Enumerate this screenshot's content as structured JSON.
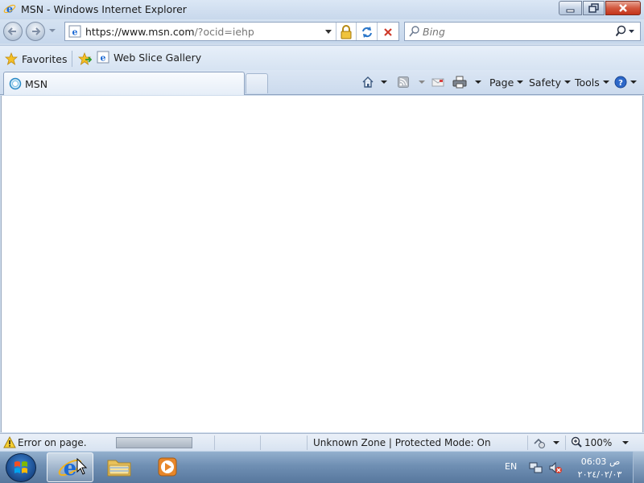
{
  "window": {
    "title": "MSN - Windows Internet Explorer",
    "title_icon": "ie-icon",
    "minimize_icon": "minimize-icon",
    "maximize_icon": "restore-icon",
    "close_icon": "close-icon"
  },
  "navigation": {
    "back_icon": "back-arrow-icon",
    "forward_icon": "forward-arrow-icon",
    "address": {
      "scheme_host": "https://www.msn.com",
      "path": "/?ocid=iehp"
    },
    "security_icon": "lock-icon",
    "refresh_icon": "refresh-icon",
    "stop_icon": "stop-icon",
    "search_placeholder": "Bing"
  },
  "favorites_bar": {
    "favorites_label": "Favorites",
    "web_slice_label": "Web Slice Gallery"
  },
  "tabs": [
    {
      "label": "MSN",
      "active": true
    }
  ],
  "command_bar": {
    "page_label": "Page",
    "safety_label": "Safety",
    "tools_label": "Tools"
  },
  "status_bar": {
    "message": "Error on page.",
    "progress_fraction": 1.0,
    "zone": "Unknown Zone | Protected Mode: On",
    "zoom": "100%"
  },
  "taskbar": {
    "language": "EN",
    "time": "06:03 ص",
    "date": "٢٠٢٤/٠٢/٠٣"
  },
  "colors": {
    "accent": "#1c6fd1",
    "close_button": "#c4341a",
    "frame": "#cfdcec"
  }
}
